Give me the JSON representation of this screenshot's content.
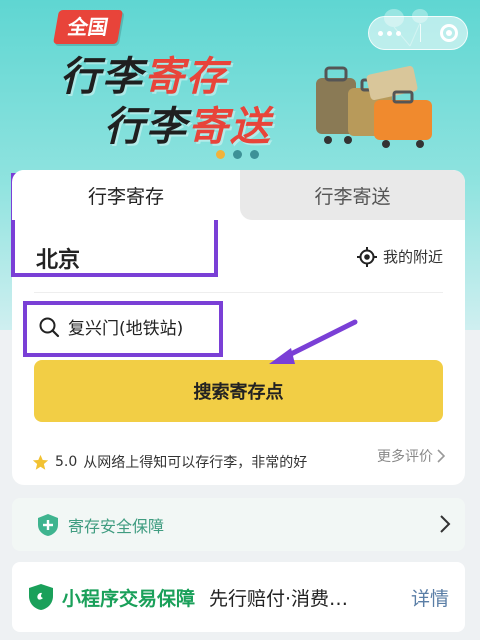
{
  "banner": {
    "tag": "全国",
    "line1_a": "行李",
    "line1_b": "寄存",
    "line2_a": "行李",
    "line2_b": "寄送",
    "carousel_count": 3,
    "carousel_active": 1
  },
  "tabs": [
    {
      "label": "行李寄存",
      "active": true
    },
    {
      "label": "行李寄送",
      "active": false
    }
  ],
  "city": "北京",
  "nearby_label": "我的附近",
  "search_value": "复兴门(地铁站)",
  "search_button": "搜索寄存点",
  "review": {
    "rating": "5.0",
    "text": "从网络上得知可以存行李，非常的好",
    "more_label": "更多评价"
  },
  "safety": {
    "label": "寄存安全保障"
  },
  "guarantee": {
    "title": "小程序交易保障",
    "desc": "先行赔付·消费…",
    "detail_label": "详情"
  },
  "colors": {
    "accent": "#f2ce45",
    "highlight": "#7a3fd6",
    "banner_red": "#e8443a",
    "safe_green": "#3f9c80",
    "guarantee_green": "#1aa05a",
    "link_blue": "#5a7ea6"
  },
  "icons": {
    "menu": "more-dots-icon",
    "close": "close-target-icon",
    "location": "location-icon",
    "search": "search-icon",
    "star": "star-icon",
    "chevron": "chevron-right-icon",
    "shield": "shield-plus-icon",
    "guarantee": "shield-icon"
  }
}
